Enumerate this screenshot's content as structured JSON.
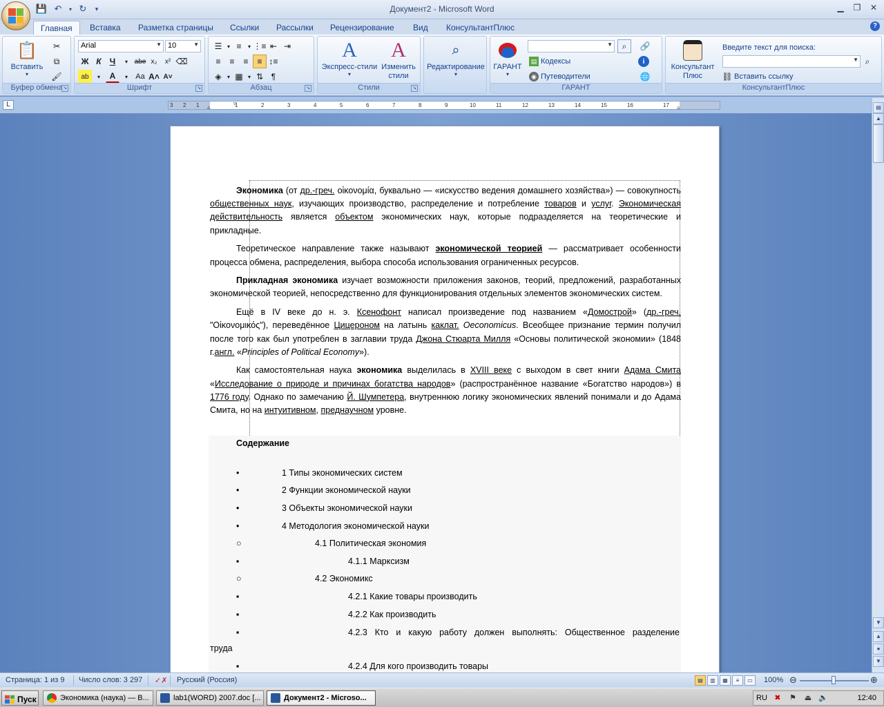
{
  "window": {
    "title": "Документ2 - Microsoft Word"
  },
  "ribbon_tabs": [
    "Главная",
    "Вставка",
    "Разметка страницы",
    "Ссылки",
    "Рассылки",
    "Рецензирование",
    "Вид",
    "КонсультантПлюс"
  ],
  "ribbon": {
    "clipboard": {
      "paste_label": "Вставить",
      "group_label": "Буфер обмена"
    },
    "font": {
      "font_name": "Arial",
      "font_size": "10",
      "group_label": "Шрифт",
      "bold": "Ж",
      "italic": "К",
      "underline": "Ч",
      "strike": "abe",
      "case": "Aa"
    },
    "paragraph": {
      "group_label": "Абзац"
    },
    "styles": {
      "express_label": "Экспресс-стили",
      "change_label": "Изменить стили",
      "group_label": "Стили"
    },
    "editing": {
      "label": "Редактирование"
    },
    "garant": {
      "garant_label": "ГАРАНТ",
      "codecs_label": "Кодексы",
      "guides_label": "Путеводители",
      "group_label": "ГАРАНТ"
    },
    "consultant": {
      "btn_label": "Консультант Плюс",
      "search_prompt": "Введите текст для поиска:",
      "insert_link": "Вставить ссылку",
      "group_label": "КонсультантПлюс"
    }
  },
  "ruler": {
    "marks": [
      "3",
      "2",
      "1",
      "1",
      "2",
      "3",
      "4",
      "5",
      "6",
      "7",
      "8",
      "9",
      "10",
      "11",
      "12",
      "13",
      "14",
      "15",
      "16",
      "17"
    ]
  },
  "document": {
    "paragraphs": [
      [
        "Экономика",
        " (от ",
        "др.-греч.",
        " οἰκονομία, буквально — «искусство ведения домашнего хозяйства») — совокупность ",
        "общественных наук",
        ", изучающих производство, распределение и потребление ",
        "товаров",
        " и ",
        "услуг",
        ". ",
        "Экономическая действительность",
        " является ",
        "объектом",
        " экономических наук, которые подразделяется на теоретические и прикладные."
      ],
      [
        "Теоретическое направление также называют ",
        "экономической теорией",
        " — рассматривает особенности процесса обмена, распределения, выбора способа использования ограниченных ресурсов."
      ],
      [
        "Прикладная экономика",
        " изучает возможности приложения законов, теорий, предложений, разработанных экономической теорией, непосредственно для функционирования отдельных элементов экономических систем."
      ],
      [
        "Ещё в IV веке до н. э. ",
        "Ксенофонт",
        " написал произведение под названием «",
        "Домострой",
        "» (",
        "др.-греч.",
        " \"Οἰκονομικός\"), переведённое ",
        "Цицероном",
        " на латынь ",
        "каклат.",
        " ",
        "Oeconomicus",
        ". Всеобщее признание термин получил после того как был употреблен в заглавии труда ",
        "Джона Стюарта Милля",
        " «Основы политической экономии» (1848 г.",
        "англ.",
        " «",
        "Principles of Political Economy",
        "»)."
      ],
      [
        "Как самостоятельная наука ",
        "экономика",
        " выделилась в ",
        "XVIII веке",
        " с выходом в свет книги ",
        "Адама Смита",
        " «",
        "Исследование о природе и причинах богатства народов",
        "» (распространённое название «Богатство народов») в ",
        "1776 году",
        ". Однако по замечанию ",
        "Й. Шумпетера",
        ", внутреннюю логику экономических явлений понимали и до Адама Смита, но на ",
        "интуитивном",
        ", ",
        "преднаучном",
        " уровне."
      ]
    ],
    "toc": {
      "title": "Содержание",
      "items": [
        {
          "bullet": "•",
          "text": "1 Типы экономических систем"
        },
        {
          "bullet": "•",
          "text": "2 Функции экономической науки"
        },
        {
          "bullet": "•",
          "text": "3 Объекты экономической науки"
        },
        {
          "bullet": "•",
          "text": "4 Методология экономической науки"
        },
        {
          "bullet": "○",
          "text": "4.1 Политическая экономия"
        },
        {
          "bullet": "▪",
          "text": "4.1.1 Марксизм"
        },
        {
          "bullet": "○",
          "text": "4.2 Экономикс"
        },
        {
          "bullet": "▪",
          "text": "4.2.1 Какие товары производить"
        },
        {
          "bullet": "▪",
          "text": "4.2.2 Как производить"
        },
        {
          "bullet": "▪",
          "text": "4.2.3 Кто и какую работу должен выполнять: Общественное разделение"
        },
        {
          "bullet": "",
          "text": "труда"
        },
        {
          "bullet": "▪",
          "text": "4.2.4 Для кого производить товары"
        }
      ]
    }
  },
  "statusbar": {
    "page": "Страница: 1 из 9",
    "words": "Число слов: 3 297",
    "language": "Русский (Россия)",
    "zoom": "100%"
  },
  "taskbar": {
    "start": "Пуск",
    "tasks": [
      "Экономика (наука) — В...",
      "lab1(WORD) 2007.doc [...",
      "Документ2 - Microso..."
    ],
    "lang": "RU",
    "clock": "12:40"
  }
}
